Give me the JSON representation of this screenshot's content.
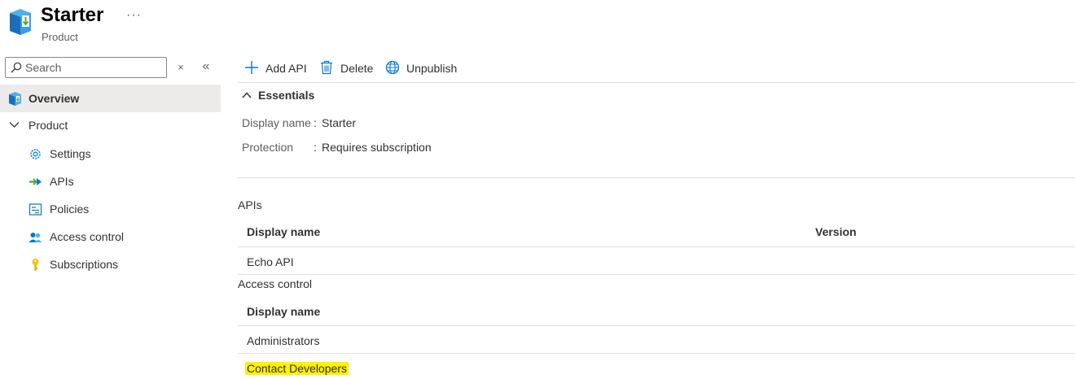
{
  "header": {
    "title": "Starter",
    "subtitle": "Product",
    "more_label": "···"
  },
  "sidebar": {
    "search_placeholder": "Search",
    "clear_label": "×",
    "collapse_label": "«",
    "items": [
      {
        "label": "Overview",
        "icon": "overview-icon",
        "selected": true
      },
      {
        "label": "Product",
        "icon": "chevron-down-icon"
      },
      {
        "label": "Settings",
        "icon": "gear-icon"
      },
      {
        "label": "APIs",
        "icon": "api-icon"
      },
      {
        "label": "Policies",
        "icon": "policies-icon"
      },
      {
        "label": "Access control",
        "icon": "people-icon"
      },
      {
        "label": "Subscriptions",
        "icon": "key-icon"
      }
    ]
  },
  "toolbar": {
    "add_api": "Add API",
    "delete": "Delete",
    "unpublish": "Unpublish"
  },
  "essentials": {
    "heading": "Essentials",
    "rows": [
      {
        "key": "Display name",
        "value": "Starter"
      },
      {
        "key": "Protection",
        "value": "Requires subscription"
      }
    ]
  },
  "apis": {
    "title": "APIs",
    "columns": [
      "Display name",
      "Version"
    ],
    "rows": [
      {
        "name": "Echo API",
        "version": ""
      }
    ]
  },
  "access_control": {
    "title": "Access control",
    "columns": [
      "Display name"
    ],
    "rows": [
      "Administrators",
      "Contact Developers"
    ]
  },
  "colors": {
    "accent": "#0078d4",
    "selected_bg": "#edebe9",
    "highlight": "#fff100"
  }
}
